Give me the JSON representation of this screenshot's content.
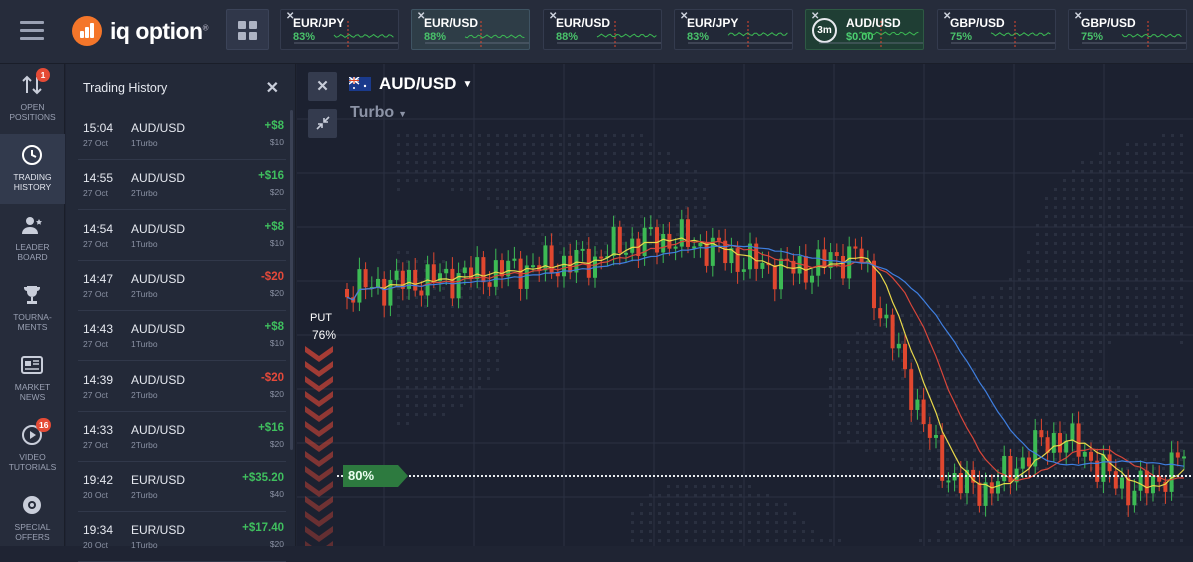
{
  "brand": {
    "logo_text": "iq option",
    "reg": "®"
  },
  "topbar": {
    "tabs": [
      {
        "name": "EUR/JPY",
        "pct": "83%"
      },
      {
        "name": "EUR/USD",
        "pct": "88%"
      },
      {
        "name": "EUR/USD",
        "pct": "88%"
      },
      {
        "name": "EUR/JPY",
        "pct": "83%"
      },
      {
        "name": "AUD/USD",
        "pct": "$0.00",
        "timer": "3m"
      },
      {
        "name": "GBP/USD",
        "pct": "75%"
      },
      {
        "name": "GBP/USD",
        "pct": "75%"
      }
    ]
  },
  "nav": {
    "items": [
      {
        "label": "OPEN POSITIONS",
        "icon": "arrows-updown-icon",
        "badge": "1"
      },
      {
        "label": "TRADING HISTORY",
        "icon": "history-clock-icon"
      },
      {
        "label": "LEADER BOARD",
        "icon": "leaderboard-user-icon"
      },
      {
        "label": "TOURNA-MENTS",
        "icon": "trophy-icon"
      },
      {
        "label": "MARKET NEWS",
        "icon": "newspaper-icon"
      },
      {
        "label": "VIDEO TUTORIALS",
        "icon": "play-circle-icon",
        "badge": "16"
      },
      {
        "label": "SPECIAL OFFERS",
        "icon": "gear-badge-icon"
      }
    ]
  },
  "history": {
    "title": "Trading History",
    "rows": [
      {
        "time": "15:04",
        "date": "27 Oct",
        "asset": "AUD/USD",
        "expiry": "1Turbo",
        "profit": "+$8",
        "stake": "$10",
        "positive": true
      },
      {
        "time": "14:55",
        "date": "27 Oct",
        "asset": "AUD/USD",
        "expiry": "2Turbo",
        "profit": "+$16",
        "stake": "$20",
        "positive": true
      },
      {
        "time": "14:54",
        "date": "27 Oct",
        "asset": "AUD/USD",
        "expiry": "1Turbo",
        "profit": "+$8",
        "stake": "$10",
        "positive": true
      },
      {
        "time": "14:47",
        "date": "27 Oct",
        "asset": "AUD/USD",
        "expiry": "2Turbo",
        "profit": "-$20",
        "stake": "$20",
        "positive": false
      },
      {
        "time": "14:43",
        "date": "27 Oct",
        "asset": "AUD/USD",
        "expiry": "1Turbo",
        "profit": "+$8",
        "stake": "$10",
        "positive": true
      },
      {
        "time": "14:39",
        "date": "27 Oct",
        "asset": "AUD/USD",
        "expiry": "2Turbo",
        "profit": "-$20",
        "stake": "$20",
        "positive": false
      },
      {
        "time": "14:33",
        "date": "27 Oct",
        "asset": "AUD/USD",
        "expiry": "2Turbo",
        "profit": "+$16",
        "stake": "$20",
        "positive": true
      },
      {
        "time": "19:42",
        "date": "20 Oct",
        "asset": "EUR/USD",
        "expiry": "2Turbo",
        "profit": "+$35.20",
        "stake": "$40",
        "positive": true
      },
      {
        "time": "19:34",
        "date": "20 Oct",
        "asset": "EUR/USD",
        "expiry": "1Turbo",
        "profit": "+$17.40",
        "stake": "$20",
        "positive": true
      }
    ]
  },
  "chart": {
    "pair": "AUD/USD",
    "mode": "Turbo",
    "put_label": "PUT",
    "put_pct": "76%",
    "payout_tag": "80%",
    "colors": {
      "up": "#3cba54",
      "down": "#e0472f",
      "ma_yellow": "#e8d84a",
      "ma_red": "#d9463a",
      "ma_blue": "#3f7fe0"
    }
  }
}
